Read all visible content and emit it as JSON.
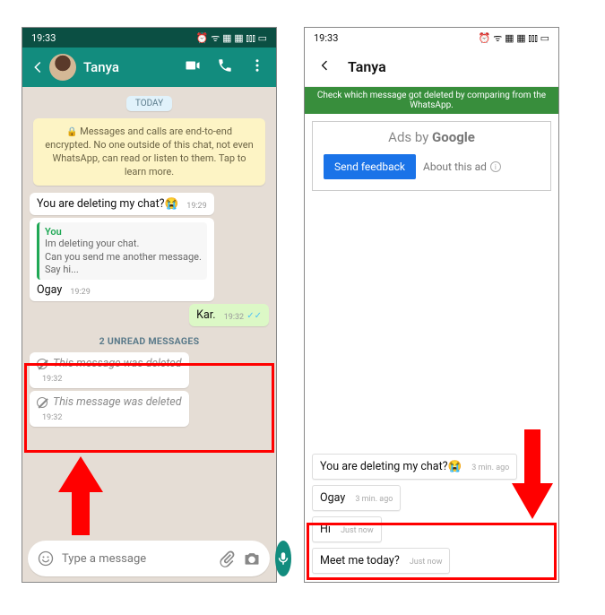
{
  "left": {
    "statusbar": {
      "time": "19:33",
      "icons": "⏰ ᯤ ▦ ▦ ⫾⫾⫾ ▭"
    },
    "header": {
      "name": "Tanya"
    },
    "day_label": "TODAY",
    "e2e_notice": "Messages and calls are end-to-end encrypted. No one outside of this chat, not even WhatsApp, can read or listen to them. Tap to learn more.",
    "msg1": {
      "text": "You are deleting my chat?",
      "time": "19:29",
      "emoji": "😭"
    },
    "quoted": {
      "name": "You",
      "text": "Im deleting your chat.\nCan you send me another message.\nSay hi..."
    },
    "msg2": {
      "text": "Ogay",
      "time": "19:29"
    },
    "msg3": {
      "text": "Kar.",
      "time": "19:32"
    },
    "unread_label": "2 UNREAD MESSAGES",
    "deleted1": {
      "text": "This message was deleted",
      "time": "19:32"
    },
    "deleted2": {
      "text": "This message was deleted",
      "time": "19:32"
    },
    "input_placeholder": "Type a message"
  },
  "right": {
    "statusbar": {
      "time": "19:33",
      "icons": "⏰ ᯤ ▦ ▦ ⫾⫾⫾ ▭"
    },
    "header": {
      "name": "Tanya"
    },
    "banner": "Check which message got deleted by comparing from the WhatsApp.",
    "ads": {
      "title_prefix": "Ads by ",
      "title_brand": "Google",
      "feedback": "Send feedback",
      "about": "About this ad"
    },
    "m1": {
      "text": "You are deleting my chat?",
      "emoji": "😭",
      "time": "3 min. ago"
    },
    "m2": {
      "text": "Ogay",
      "time": "3 min. ago"
    },
    "m3": {
      "text": "Hi",
      "time": "Just now"
    },
    "m4": {
      "text": "Meet me today?",
      "time": "Just now"
    }
  }
}
